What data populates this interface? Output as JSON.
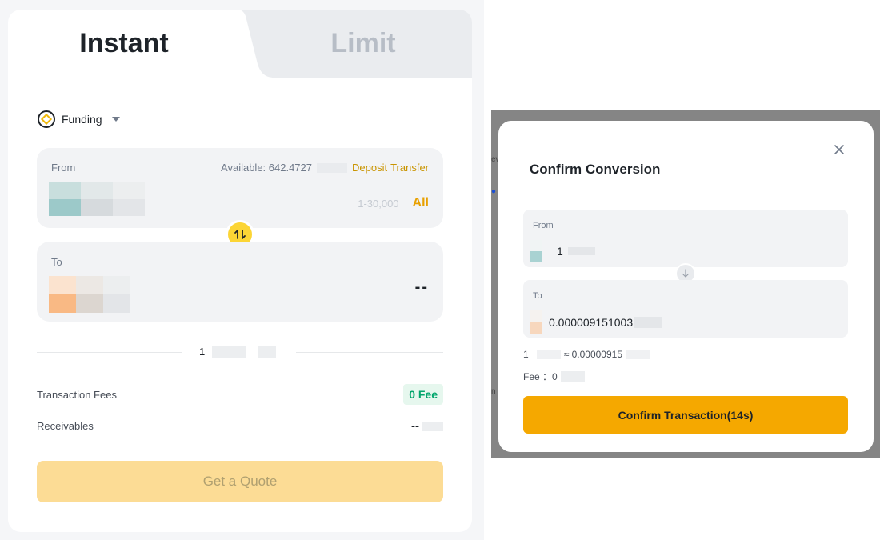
{
  "tabs": {
    "instant_label": "Instant",
    "limit_label": "Limit"
  },
  "wallet": {
    "label": "Funding",
    "icon": "funding-wallet-icon"
  },
  "from_box": {
    "label": "From",
    "available_text": "Available: 642.4727",
    "deposit_label": "Deposit",
    "transfer_label": "Transfer",
    "range": "1-30,000",
    "all_label": "All"
  },
  "to_box": {
    "label": "To",
    "amount": "--"
  },
  "rate": {
    "text": "1"
  },
  "fees": {
    "transaction_fees_label": "Transaction Fees",
    "transaction_fees_value": "0 Fee",
    "receivables_label": "Receivables",
    "receivables_value": "--"
  },
  "quote_button": {
    "label": "Get a Quote"
  },
  "modal": {
    "title": "Confirm Conversion",
    "from_label": "From",
    "from_value": "1",
    "to_label": "To",
    "to_value": "0.000009151003",
    "rate_prefix": "1",
    "rate_value": "≈ 0.00000915",
    "fee_text": "Fee ：0",
    "confirm_label": "Confirm Transaction(14s)"
  },
  "colors": {
    "accent": "#f0b90b",
    "confirm": "#f5a800",
    "fee_green": "#03a66d",
    "link": "#c99400"
  }
}
